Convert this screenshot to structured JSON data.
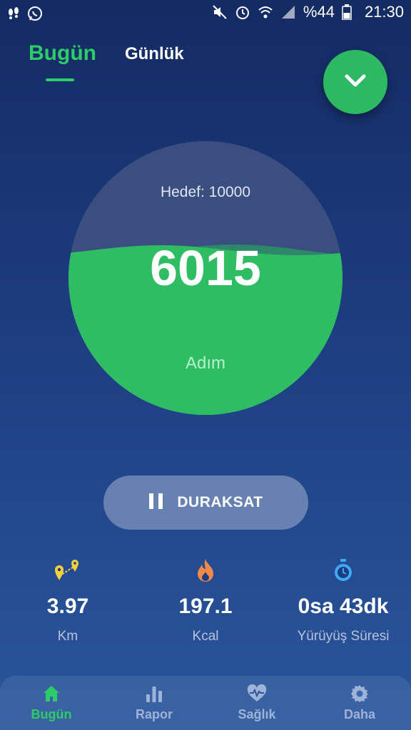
{
  "status_bar": {
    "battery_text": "%44",
    "time": "21:30",
    "icons": [
      "steps-notification-icon",
      "whatsapp-icon",
      "mute-icon",
      "alarm-icon",
      "wifi-icon",
      "signal-icon",
      "battery-icon"
    ]
  },
  "tabs": [
    {
      "label": "Bugün",
      "active": true
    },
    {
      "label": "Günlük",
      "active": false
    }
  ],
  "gauge": {
    "goal_text": "Hedef: 10000",
    "steps": "6015",
    "unit": "Adım",
    "progress": 0.6015
  },
  "pause_button": {
    "label": "DURAKSAT"
  },
  "stats": [
    {
      "value": "3.97",
      "label": "Km",
      "icon": "route-icon"
    },
    {
      "value": "197.1",
      "label": "Kcal",
      "icon": "flame-icon"
    },
    {
      "value": "0sa 43dk",
      "label": "Yürüyüş Süresi",
      "icon": "stopwatch-icon"
    }
  ],
  "bottom_nav": [
    {
      "label": "Bugün",
      "icon": "home-icon",
      "active": true
    },
    {
      "label": "Rapor",
      "icon": "bar-chart-icon",
      "active": false
    },
    {
      "label": "Sağlık",
      "icon": "heart-pulse-icon",
      "active": false
    },
    {
      "label": "Daha",
      "icon": "gear-icon",
      "active": false
    }
  ],
  "colors": {
    "accent": "#2ecc68",
    "gauge_fill": "#2ebd63",
    "gauge_empty": "#3a4f80",
    "background_top": "#142b63",
    "background_bottom": "#2a569c"
  }
}
